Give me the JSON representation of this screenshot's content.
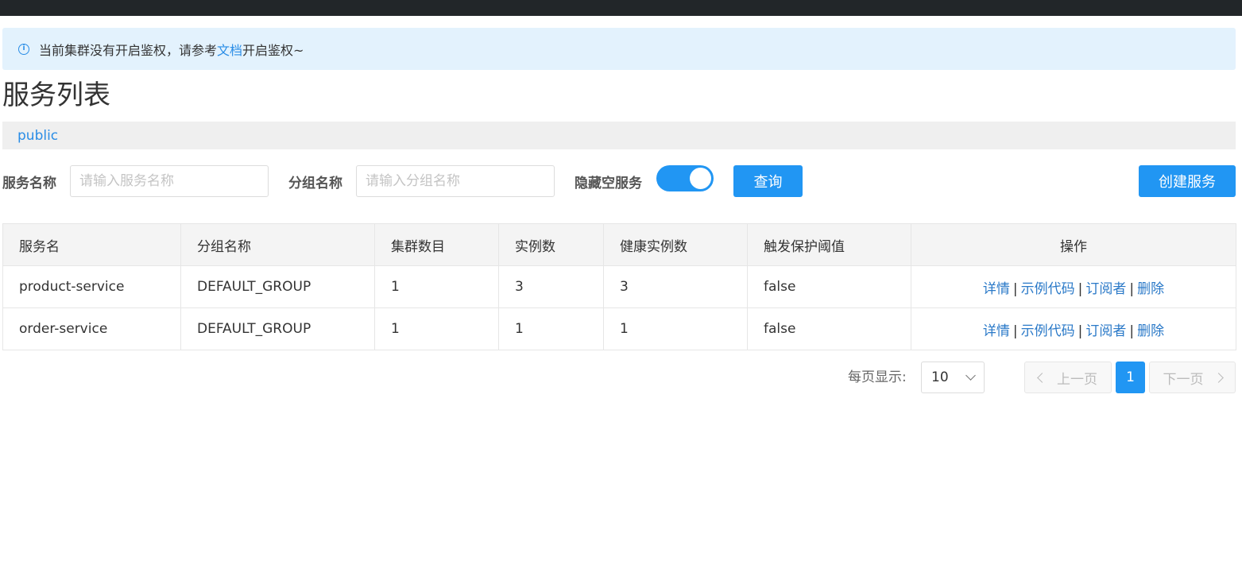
{
  "notice": {
    "text_before": "当前集群没有开启鉴权，请参考",
    "link": "文档",
    "text_after": "开启鉴权~"
  },
  "page": {
    "title": "服务列表"
  },
  "namespace": {
    "current": "public"
  },
  "filters": {
    "service_name_label": "服务名称",
    "service_name_placeholder": "请输入服务名称",
    "group_name_label": "分组名称",
    "group_name_placeholder": "请输入分组名称",
    "hide_empty_label": "隐藏空服务",
    "hide_empty_on": true,
    "query_button": "查询",
    "create_button": "创建服务"
  },
  "table": {
    "headers": [
      "服务名",
      "分组名称",
      "集群数目",
      "实例数",
      "健康实例数",
      "触发保护阈值",
      "操作"
    ],
    "rows": [
      [
        "product-service",
        "DEFAULT_GROUP",
        "1",
        "3",
        "3",
        "false"
      ],
      [
        "order-service",
        "DEFAULT_GROUP",
        "1",
        "1",
        "1",
        "false"
      ]
    ],
    "actions": {
      "detail": "详情",
      "sample_code": "示例代码",
      "subscribers": "订阅者",
      "delete": "删除",
      "separator": "|"
    }
  },
  "pagination": {
    "page_size_label": "每页显示:",
    "page_size": "10",
    "prev": "上一页",
    "next": "下一页",
    "current_page": "1"
  },
  "colors": {
    "primary": "#2196f3",
    "link": "#2a79c8",
    "notice_bg": "#e3f2fd",
    "topbar": "#222629"
  }
}
